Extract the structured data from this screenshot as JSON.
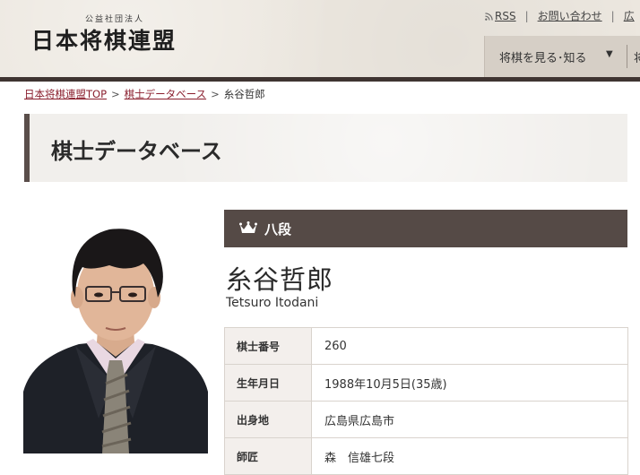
{
  "header": {
    "logo_sub": "公益社団法人",
    "logo_main": "日本将棋連盟",
    "links": {
      "rss": "RSS",
      "contact": "お問い合わせ",
      "next": "広"
    },
    "nav": {
      "item1": "将棋を見る･知る",
      "caret": "▼",
      "next": "将"
    }
  },
  "breadcrumb": {
    "home": "日本将棋連盟TOP",
    "db": "棋士データベース",
    "current": "糸谷哲郎",
    "arrow": ">"
  },
  "page": {
    "title": "棋士データベース"
  },
  "player": {
    "rank": "八段",
    "name_ja": "糸谷哲郎",
    "name_en": "Tetsuro Itodani",
    "profile": [
      {
        "label": "棋士番号",
        "value": "260"
      },
      {
        "label": "生年月日",
        "value": "1988年10月5日(35歳)"
      },
      {
        "label": "出身地",
        "value": "広島県広島市"
      },
      {
        "label": "師匠",
        "value": "森　信雄七段"
      }
    ]
  },
  "colors": {
    "accent_dark": "#554a46",
    "link": "#8a1f2e",
    "header_bg": "#ece7df"
  }
}
